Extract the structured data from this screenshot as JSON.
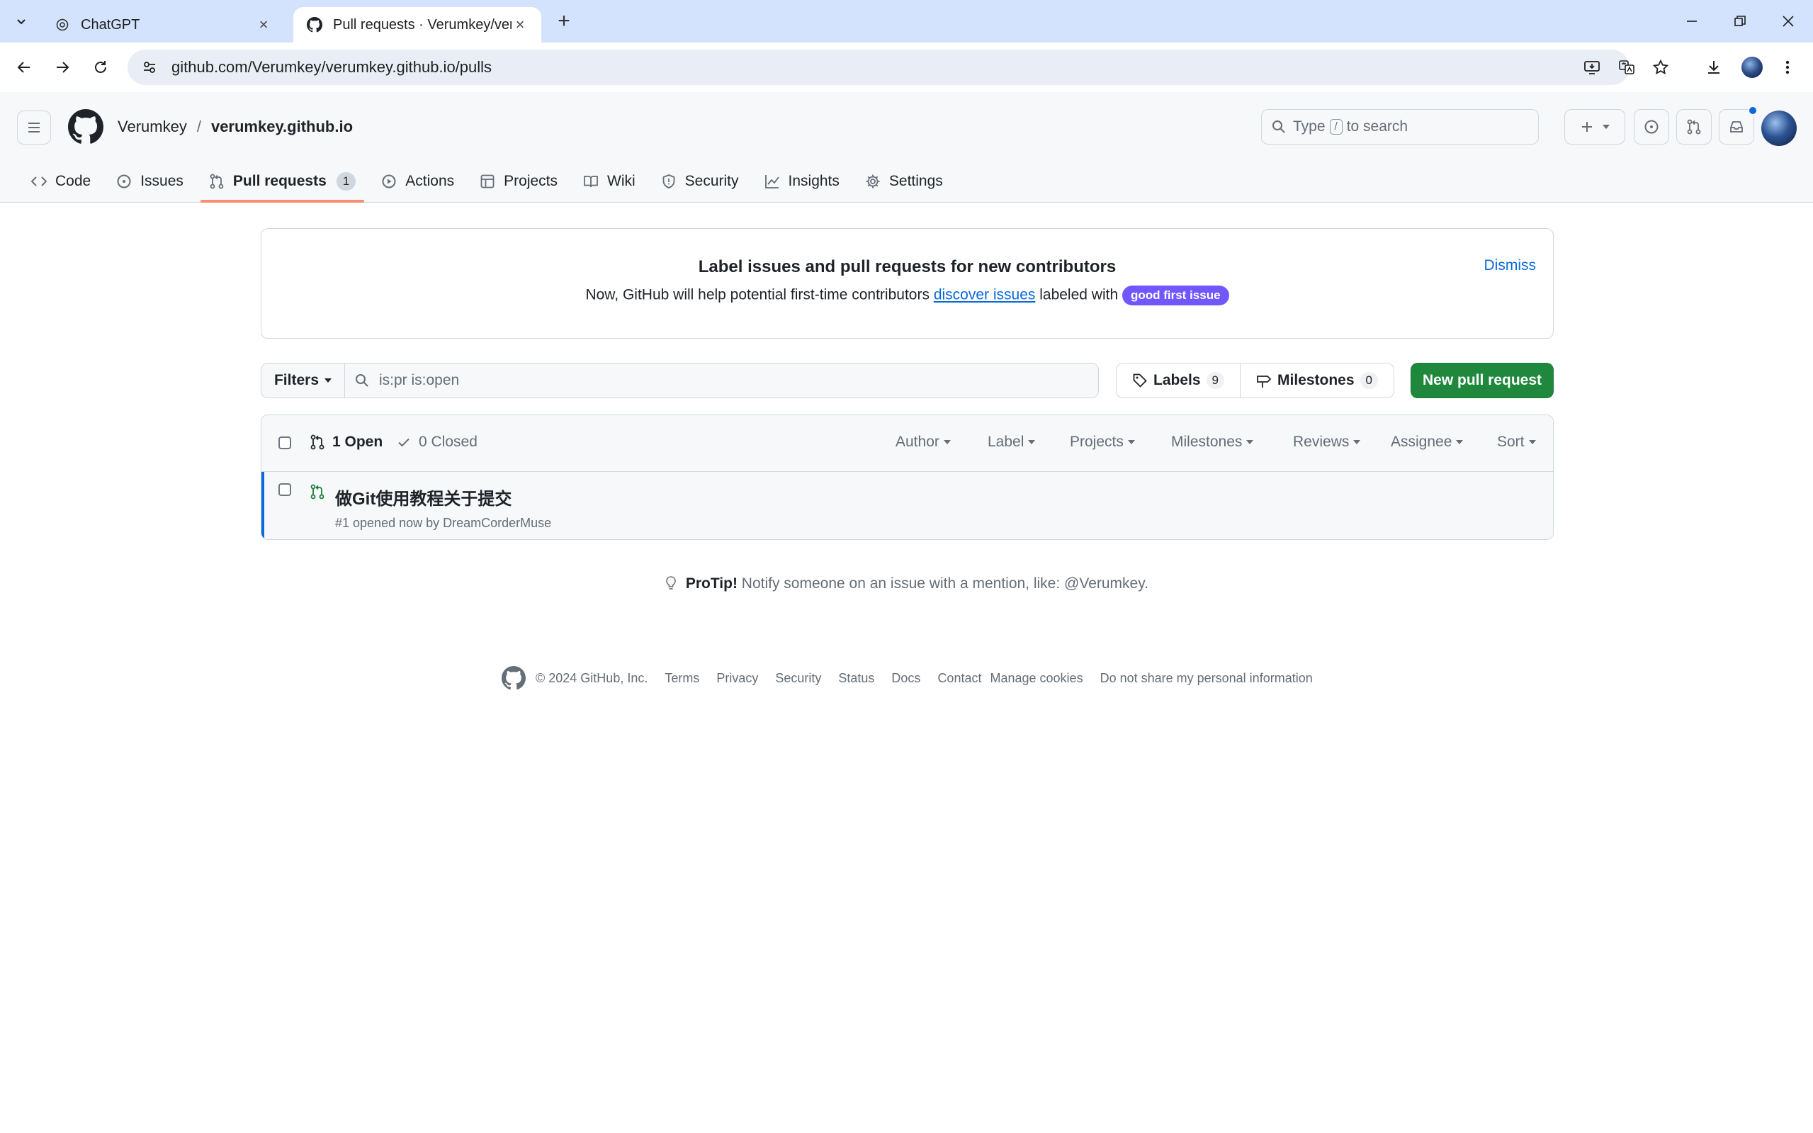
{
  "browser": {
    "tabs": [
      {
        "title": "ChatGPT",
        "active": false
      },
      {
        "title": "Pull requests · Verumkey/verumkey.github.io",
        "active": true
      }
    ],
    "url": "github.com/Verumkey/verumkey.github.io/pulls"
  },
  "header": {
    "owner": "Verumkey",
    "separator": "/",
    "repo": "verumkey.github.io",
    "search": {
      "before": "Type",
      "key": "/",
      "after": "to search"
    }
  },
  "repo_nav": {
    "code": "Code",
    "issues": "Issues",
    "pull_requests": "Pull requests",
    "pull_requests_count": "1",
    "actions": "Actions",
    "projects": "Projects",
    "wiki": "Wiki",
    "security": "Security",
    "insights": "Insights",
    "settings": "Settings"
  },
  "banner": {
    "title": "Label issues and pull requests for new contributors",
    "text_before": "Now, GitHub will help potential first-time contributors",
    "link": "discover issues",
    "text_after": "labeled with",
    "label": "good first issue",
    "dismiss": "Dismiss"
  },
  "filters": {
    "button": "Filters",
    "query": "is:pr is:open"
  },
  "labels_btn": {
    "label": "Labels",
    "count": "9"
  },
  "milestones_btn": {
    "label": "Milestones",
    "count": "0"
  },
  "new_pr": "New pull request",
  "list": {
    "open": "1 Open",
    "closed": "0 Closed",
    "filters": {
      "author": "Author",
      "label": "Label",
      "projects": "Projects",
      "milestones": "Milestones",
      "reviews": "Reviews",
      "assignee": "Assignee",
      "sort": "Sort"
    },
    "items": [
      {
        "title": "做Git使用教程关于提交",
        "meta": "#1 opened now by DreamCorderMuse"
      }
    ]
  },
  "protip": {
    "lead": "ProTip!",
    "text": "Notify someone on an issue with a mention, like: @Verumkey."
  },
  "footer": {
    "copyright": "© 2024 GitHub, Inc.",
    "links": [
      "Terms",
      "Privacy",
      "Security",
      "Status",
      "Docs",
      "Contact",
      "Manage cookies",
      "Do not share my personal information"
    ]
  },
  "colors": {
    "accent": "#0969da",
    "primary_button": "#1f883d",
    "selected_tab_underline": "#fd8c73",
    "good_first_issue": "#7057ff"
  }
}
